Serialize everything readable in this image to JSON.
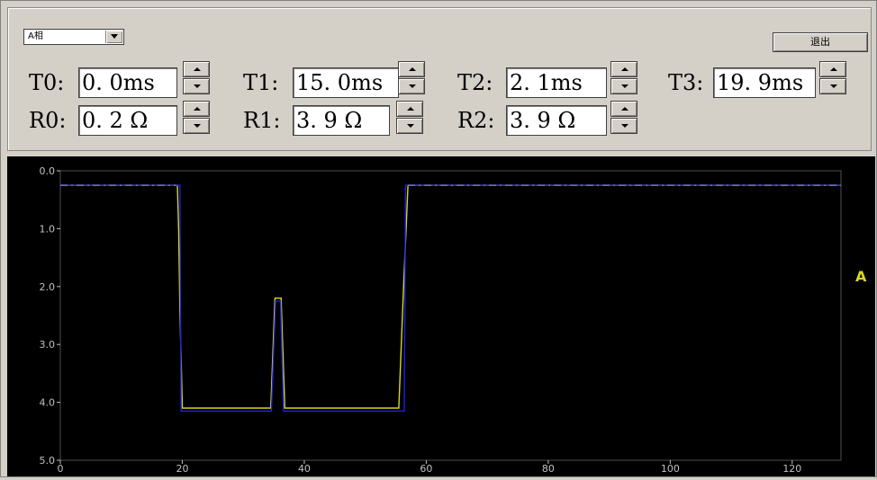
{
  "phase_select": {
    "selected": "A相"
  },
  "exit_button": {
    "label": "退出"
  },
  "params": {
    "t0": {
      "label": "T0:",
      "value": "0. 0ms"
    },
    "t1": {
      "label": "T1:",
      "value": "15. 0ms"
    },
    "t2": {
      "label": "T2:",
      "value": "2. 1ms"
    },
    "t3": {
      "label": "T3:",
      "value": "19. 9ms"
    },
    "r0": {
      "label": "R0:",
      "value": "0. 2 Ω"
    },
    "r1": {
      "label": "R1:",
      "value": "3. 9 Ω"
    },
    "r2": {
      "label": "R2:",
      "value": "3. 9 Ω"
    }
  },
  "chart_data": {
    "type": "line",
    "title": "",
    "xlabel": "",
    "ylabel": "",
    "xlim": [
      0,
      128
    ],
    "ylim": [
      0,
      5
    ],
    "y_inverted": true,
    "x_ticks": [
      0,
      20,
      40,
      60,
      80,
      100,
      120
    ],
    "y_ticks": [
      0,
      1,
      2,
      3,
      4,
      5
    ],
    "x_tick_labels": [
      "0",
      "20",
      "40",
      "60",
      "80",
      "100",
      "120"
    ],
    "y_tick_labels": [
      "0.0",
      "1.0",
      "2.0",
      "3.0",
      "4.0",
      "5.0"
    ],
    "channel_label": "A",
    "colors": {
      "series_yellow": "#d8d820",
      "series_blue": "#2020e0",
      "axis": "#c0c0c0",
      "label": "#d8d820"
    },
    "series": [
      {
        "color": "#d8d820",
        "points": [
          [
            0,
            0.25
          ],
          [
            19.2,
            0.25
          ],
          [
            19.4,
            1.0
          ],
          [
            19.6,
            2.4
          ],
          [
            20.0,
            4.1
          ],
          [
            34.5,
            4.1
          ],
          [
            35.2,
            2.2
          ],
          [
            36.2,
            2.2
          ],
          [
            36.8,
            4.1
          ],
          [
            55.5,
            4.1
          ],
          [
            56.2,
            2.2
          ],
          [
            57.0,
            0.25
          ],
          [
            128,
            0.25
          ]
        ]
      },
      {
        "color": "#2020e0",
        "points": [
          [
            0,
            0.25
          ],
          [
            19.6,
            0.25
          ],
          [
            19.8,
            4.15
          ],
          [
            34.6,
            4.15
          ],
          [
            35.3,
            2.25
          ],
          [
            36.1,
            2.25
          ],
          [
            36.6,
            4.15
          ],
          [
            56.4,
            4.15
          ],
          [
            56.6,
            0.25
          ],
          [
            128,
            0.25
          ]
        ]
      }
    ]
  }
}
